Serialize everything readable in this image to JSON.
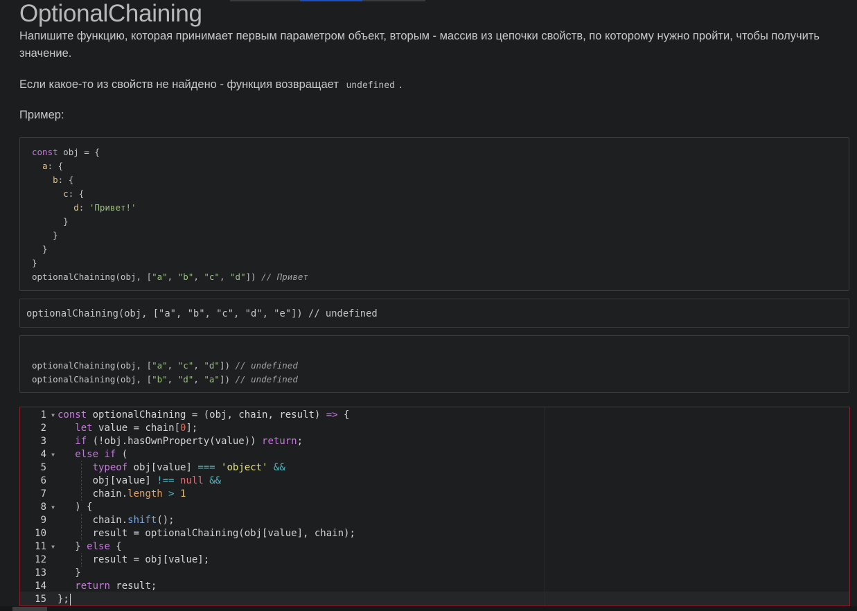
{
  "page": {
    "title": "OptionalChaining",
    "paragraph1": "Напишите функцию, которая принимает первым параметром объект, вторым - массив из цепочки свойств, по которому нужно пройти, чтобы получить значение.",
    "paragraph2_before": "Если какое-то из свойств не найдено - функция возвращает",
    "paragraph2_code": "undefined",
    "paragraph2_after": ".",
    "example_label": "Пример:"
  },
  "example1": {
    "line1_kw": "const",
    "line1_rest": " obj = {",
    "line2_key": "a",
    "line3_key": "b",
    "line4_key": "c",
    "line5_key": "d",
    "line5_str": "'Привет!'",
    "line10_call": "optionalChaining(obj, [",
    "line10_args": [
      "\"a\"",
      "\"b\"",
      "\"c\"",
      "\"d\""
    ],
    "line10_comment": "// Привет"
  },
  "example2": {
    "code": "optionalChaining(obj, [\"a\", \"b\", \"c\", \"d\", \"e\"]) // undefined"
  },
  "example3": {
    "line1_call": "optionalChaining(obj, [",
    "line1_args": [
      "\"a\"",
      "\"c\"",
      "\"d\""
    ],
    "line1_comment": "// undefined",
    "line2_call": "optionalChaining(obj, [",
    "line2_args": [
      "\"b\"",
      "\"d\"",
      "\"a\""
    ],
    "line2_comment": "// undefined"
  },
  "editor": {
    "line_numbers": [
      "1",
      "2",
      "3",
      "4",
      "5",
      "6",
      "7",
      "8",
      "9",
      "10",
      "11",
      "12",
      "13",
      "14",
      "15"
    ],
    "fold_lines": [
      1,
      4,
      8,
      11
    ],
    "tokens": {
      "const": "const",
      "fn_name": "optionalChaining",
      "params": " = (obj, chain, result) ",
      "arrow": "=>",
      "brace_open": " {",
      "let": "let",
      "value_decl": " value = chain[",
      "zero": "0",
      "close_bracket_semi": "];",
      "if": "if",
      "has_own": " (!obj.hasOwnProperty(value)) ",
      "return": "return",
      "semi": ";",
      "else_if": "else if",
      "paren_open": " (",
      "typeof": "typeof",
      "obj_value": " obj[value] ",
      "strict_eq": "===",
      "object_str": "'object'",
      "and": "&&",
      "obj_value_line6": "obj[value] ",
      "not_eq": "!==",
      "null": "null",
      "chain": "chain.",
      "length": "length",
      "gt": ">",
      "one": "1",
      "paren_close_brace": ") {",
      "shift": "shift",
      "call_parens": "();",
      "recurse": "result = optionalChaining(obj[value], chain);",
      "brace_close": "} ",
      "else": "else",
      "assign_result": "result = obj[value];",
      "close_brace": "}",
      "return_result": " result;",
      "end": "};"
    }
  }
}
